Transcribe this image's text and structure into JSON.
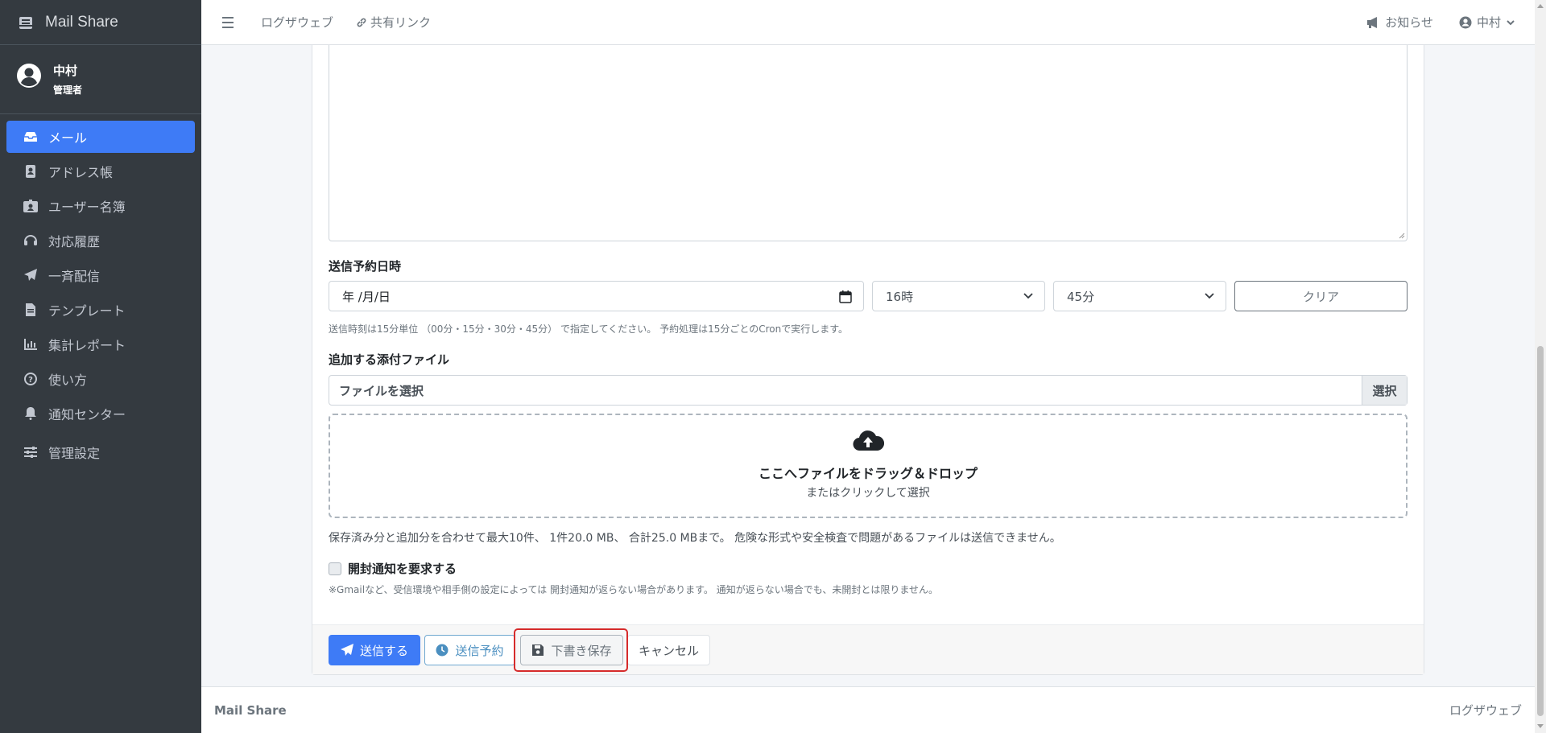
{
  "app": {
    "brand": "Mail Share"
  },
  "user": {
    "name": "中村",
    "role": "管理者"
  },
  "sidebar": {
    "items": [
      {
        "label": "メール",
        "icon": "inbox-icon",
        "active": true
      },
      {
        "label": "アドレス帳",
        "icon": "address-book-icon"
      },
      {
        "label": "ユーザー名簿",
        "icon": "id-badge-icon"
      },
      {
        "label": "対応履歴",
        "icon": "headset-icon"
      },
      {
        "label": "一斉配信",
        "icon": "paper-plane-icon"
      },
      {
        "label": "テンプレート",
        "icon": "file-icon"
      },
      {
        "label": "集計レポート",
        "icon": "chart-icon"
      },
      {
        "label": "使い方",
        "icon": "question-icon"
      },
      {
        "label": "通知センター",
        "icon": "bell-icon"
      },
      {
        "label": "管理設定",
        "icon": "sliders-icon"
      }
    ]
  },
  "topbar": {
    "link1": "ログザウェブ",
    "link2": "共有リンク",
    "notice": "お知らせ",
    "user": "中村"
  },
  "form": {
    "schedule_label": "送信予約日時",
    "date_placeholder": "年 /月/日",
    "hour_value": "16時",
    "minute_value": "45分",
    "clear_label": "クリア",
    "schedule_help": "送信時刻は15分単位 （00分・15分・30分・45分） で指定してください。 予約処理は15分ごとのCronで実行します。",
    "attach_label": "追加する添付ファイル",
    "file_text": "ファイルを選択",
    "file_button": "選択",
    "dropzone_title": "ここへファイルをドラッグ＆ドロップ",
    "dropzone_sub": "またはクリックして選択",
    "limits": "保存済み分と追加分を合わせて最大10件、 1件20.0 MB、 合計25.0 MBまで。 危険な形式や安全検査で問題があるファイルは送信できません。",
    "read_receipt_label": "開封通知を要求する",
    "read_receipt_help": "※Gmailなど、受信環境や相手側の設定によっては 開封通知が返らない場合があります。 通知が返らない場合でも、未開封とは限りません。"
  },
  "actions": {
    "send": "送信する",
    "schedule": "送信予約",
    "draft": "下書き保存",
    "cancel": "キャンセル"
  },
  "footer": {
    "left": "Mail Share",
    "right": "ログザウェブ"
  },
  "colors": {
    "primary": "#3e7bf6",
    "sidebar": "#343a40",
    "highlight": "#d62b2b"
  }
}
